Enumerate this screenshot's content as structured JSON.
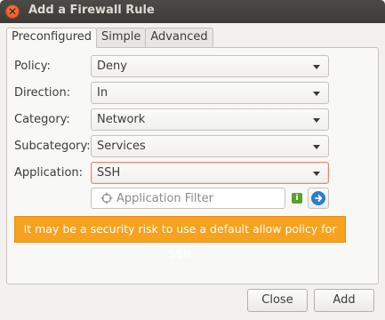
{
  "window": {
    "title": "Add a Firewall Rule",
    "close_glyph": "✕"
  },
  "tabs": [
    {
      "label": "Preconfigured",
      "active": true
    },
    {
      "label": "Simple",
      "active": false
    },
    {
      "label": "Advanced",
      "active": false
    }
  ],
  "form": {
    "policy": {
      "label": "Policy:",
      "value": "Deny"
    },
    "direction": {
      "label": "Direction:",
      "value": "In"
    },
    "category": {
      "label": "Category:",
      "value": "Network"
    },
    "subcategory": {
      "label": "Subcategory:",
      "value": "Services"
    },
    "application": {
      "label": "Application:",
      "value": "SSH"
    },
    "filter": {
      "placeholder": "Application Filter",
      "value": ""
    },
    "info_glyph": "i"
  },
  "warning": {
    "text": "It may be a security risk to use a default allow policy for SSH",
    "color": "#f6a21f"
  },
  "buttons": {
    "close": "Close",
    "add": "Add"
  },
  "colors": {
    "titlebar": "#3c3b37",
    "close_button": "#e0531f",
    "accent_focus": "#e88a6a",
    "go_button": "#2a7fd0",
    "info_badge": "#5aa02c"
  },
  "icons": {
    "close": "close-icon",
    "filter": "crosshair-icon",
    "info": "info-icon",
    "go": "arrow-right-icon"
  }
}
